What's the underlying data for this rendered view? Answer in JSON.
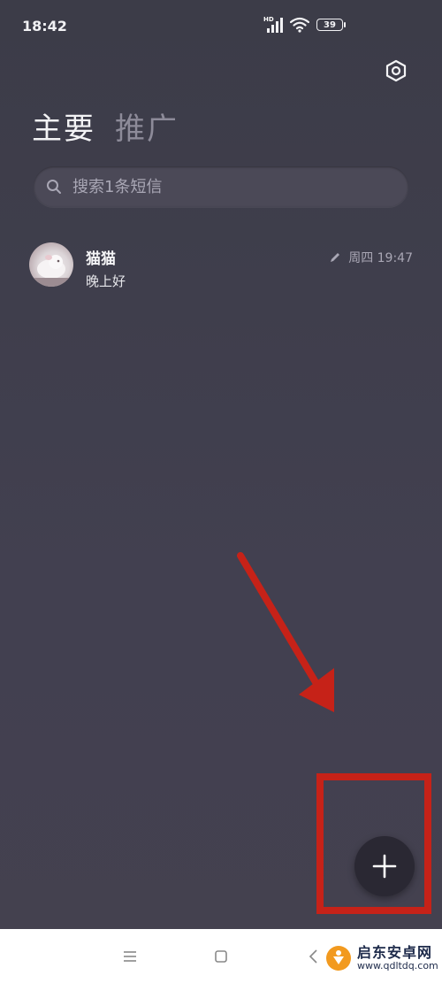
{
  "status_bar": {
    "time": "18:42",
    "hd_label": "HD",
    "battery_level": "39"
  },
  "header": {
    "tabs": [
      {
        "label": "主要",
        "active": true
      },
      {
        "label": "推广",
        "active": false
      }
    ],
    "settings_icon": "hexagon-settings-icon"
  },
  "search": {
    "placeholder": "搜索1条短信"
  },
  "conversations": [
    {
      "name": "猫猫",
      "preview": "晚上好",
      "time": "周四 19:47",
      "draft_icon": "pencil-icon"
    }
  ],
  "fab": {
    "icon": "plus-icon"
  },
  "nav_bar": {
    "icons": [
      "menu-icon",
      "home-square-icon",
      "back-chevron-icon"
    ]
  },
  "watermark": {
    "title": "启东安卓网",
    "url": "www.qdltdq.com"
  },
  "annotation": {
    "color": "#c62218",
    "description_icons": [
      "red-arrow",
      "red-highlight-box"
    ]
  }
}
